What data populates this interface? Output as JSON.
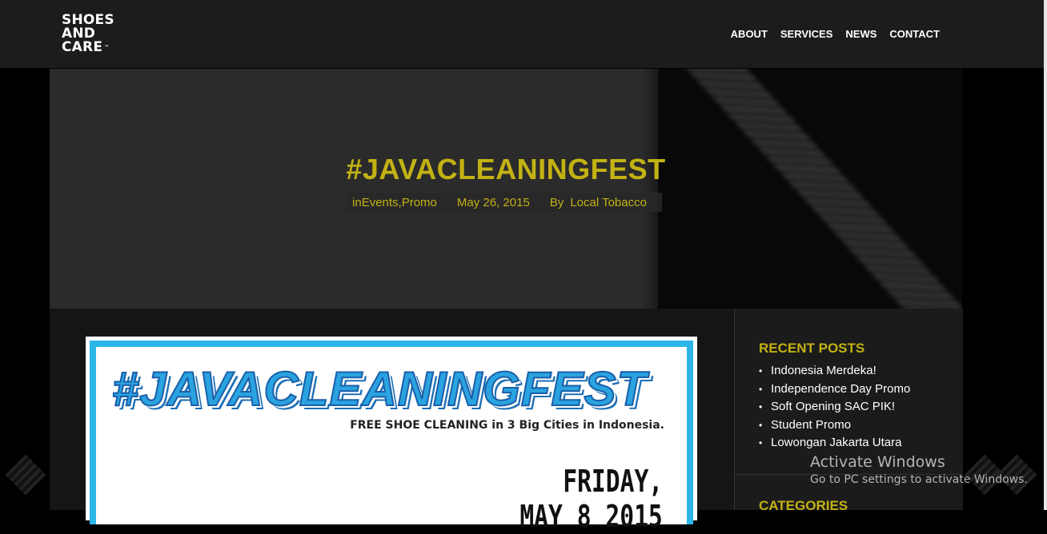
{
  "brand": {
    "logo_line1": "SHOES",
    "logo_line2": "AND",
    "logo_line3": "CARE",
    "trademark": "™"
  },
  "nav": {
    "items": [
      {
        "label": "ABOUT"
      },
      {
        "label": "SERVICES"
      },
      {
        "label": "NEWS"
      },
      {
        "label": "CONTACT"
      }
    ]
  },
  "hero": {
    "title": "#JAVACLEANINGFEST",
    "meta_in": "in ",
    "category_events": "Events",
    "category_sep": ", ",
    "category_promo": "Promo",
    "date": "May 26, 2015",
    "by": "By",
    "author": "Local Tobacco"
  },
  "post_image": {
    "title": "#JAVACLEANINGFEST",
    "subtitle": "FREE SHOE CLEANING in 3 Big Cities in Indonesia.",
    "day": "FRIDAY,",
    "date": "MAY 8 2015"
  },
  "sidebar": {
    "recent_title": "RECENT POSTS",
    "recent_posts": [
      {
        "label": "Indonesia Merdeka!"
      },
      {
        "label": "Independence Day Promo"
      },
      {
        "label": "Soft Opening SAC PIK!"
      },
      {
        "label": "Student Promo"
      },
      {
        "label": "Lowongan Jakarta Utara"
      }
    ],
    "categories_title": "CATEGORIES"
  },
  "watermark": {
    "line1": "Activate Windows",
    "line2": "Go to PC settings to activate Windows."
  },
  "colors": {
    "accent": "#c3b214",
    "header_bg": "#1c1c1c",
    "image_border": "#2cb5e8"
  }
}
